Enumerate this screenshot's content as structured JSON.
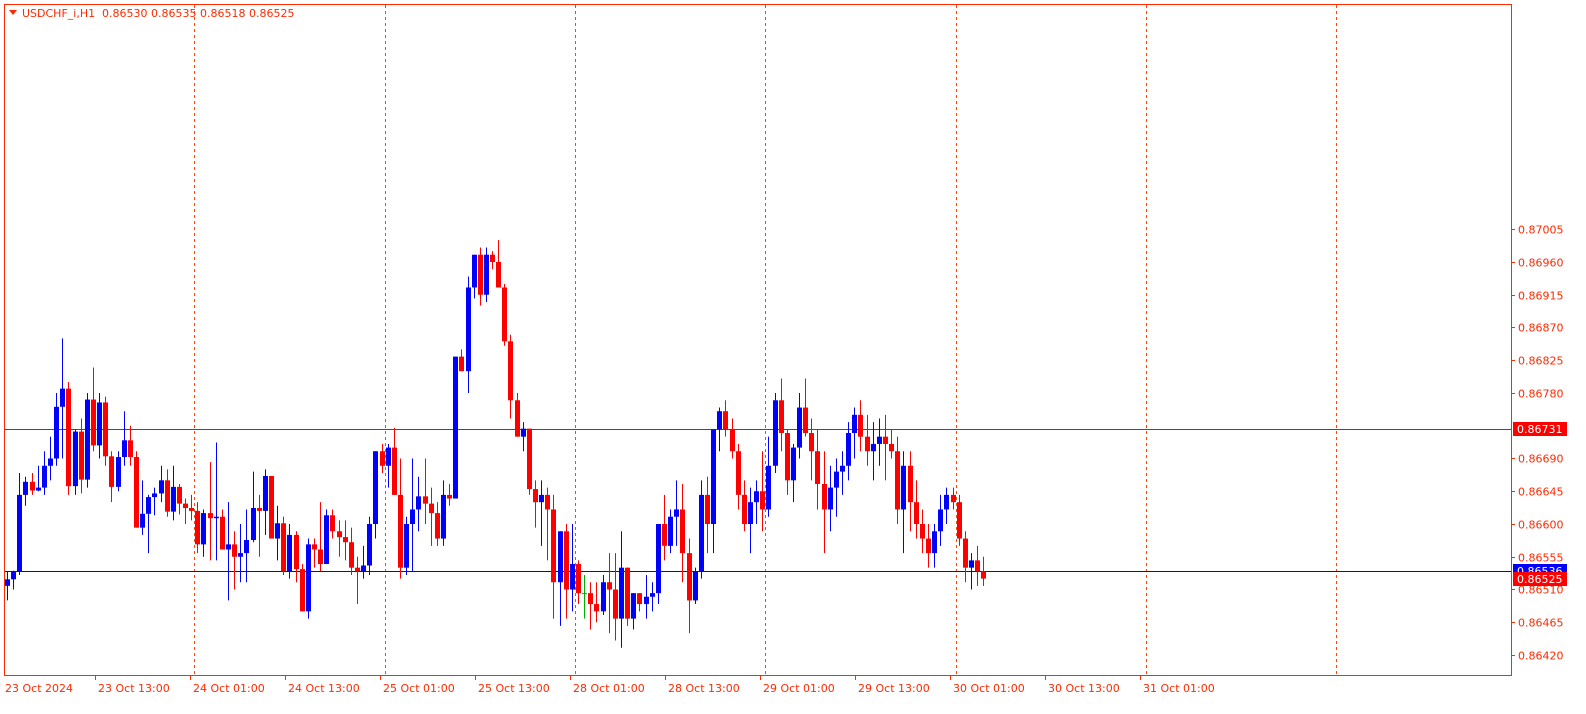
{
  "header": {
    "symbol_label": "USDCHF_i,H1",
    "ohlc_text": "0.86530 0.86535 0.86518 0.86525"
  },
  "colors": {
    "frame": "#ff2a00",
    "bull": "#0000ff",
    "bear": "#ff0000",
    "axis_text": "#ff2a00",
    "period_sep": "#ff4500",
    "hline_red": "#ff0000",
    "hline_blue": "#0000ff",
    "flat": "#00b000"
  },
  "chart_data": {
    "type": "candlestick",
    "symbol": "USDCHF_i",
    "timeframe": "H1",
    "ylim": [
      0.86405,
      0.8702
    ],
    "y_ticks": [
      "0.87005",
      "0.86960",
      "0.86915",
      "0.86870",
      "0.86825",
      "0.86780",
      "0.86690",
      "0.86645",
      "0.86600",
      "0.86555",
      "0.86510",
      "0.86465",
      "0.86420"
    ],
    "x_ticks": [
      "23 Oct 2024",
      "23 Oct 13:00",
      "24 Oct 01:00",
      "24 Oct 13:00",
      "25 Oct 01:00",
      "25 Oct 13:00",
      "28 Oct 01:00",
      "28 Oct 13:00",
      "29 Oct 01:00",
      "29 Oct 13:00",
      "30 Oct 01:00",
      "30 Oct 13:00",
      "31 Oct 01:00"
    ],
    "period_separators_after_candle": [
      30,
      61,
      92,
      123,
      154,
      185,
      216
    ],
    "horizontal_lines": [
      {
        "price": 0.86731,
        "label": "0.86731",
        "color": "#ff0000"
      },
      {
        "price": 0.86536,
        "label": "0.86536",
        "color": "#0000ff"
      }
    ],
    "bid_label": "0.86525",
    "grid": false,
    "candles": [
      [
        0.86515,
        0.86534,
        0.86495,
        0.86524
      ],
      [
        0.86524,
        0.86536,
        0.8651,
        0.86534
      ],
      [
        0.86534,
        0.8667,
        0.8653,
        0.8664
      ],
      [
        0.8664,
        0.86665,
        0.86625,
        0.86658
      ],
      [
        0.86658,
        0.8667,
        0.8664,
        0.86646
      ],
      [
        0.86646,
        0.8668,
        0.86645,
        0.8665
      ],
      [
        0.8665,
        0.867,
        0.8664,
        0.8668
      ],
      [
        0.8668,
        0.8672,
        0.8666,
        0.8669
      ],
      [
        0.8669,
        0.8678,
        0.8668,
        0.86761
      ],
      [
        0.86761,
        0.86855,
        0.8669,
        0.86786
      ],
      [
        0.86786,
        0.86795,
        0.8664,
        0.86652
      ],
      [
        0.86652,
        0.8673,
        0.8664,
        0.86727
      ],
      [
        0.86727,
        0.86745,
        0.86642,
        0.86661
      ],
      [
        0.86661,
        0.8678,
        0.8665,
        0.86771
      ],
      [
        0.86771,
        0.86815,
        0.867,
        0.86708
      ],
      [
        0.86708,
        0.8678,
        0.8669,
        0.86767
      ],
      [
        0.86767,
        0.86775,
        0.8668,
        0.86693
      ],
      [
        0.86693,
        0.867,
        0.8663,
        0.86651
      ],
      [
        0.86651,
        0.867,
        0.86645,
        0.86692
      ],
      [
        0.86692,
        0.86755,
        0.8668,
        0.86715
      ],
      [
        0.86715,
        0.86735,
        0.8668,
        0.86692
      ],
      [
        0.86692,
        0.867,
        0.866,
        0.86595
      ],
      [
        0.86595,
        0.8666,
        0.86585,
        0.86614
      ],
      [
        0.86614,
        0.8664,
        0.8656,
        0.86637
      ],
      [
        0.86637,
        0.8665,
        0.86612,
        0.86642
      ],
      [
        0.86642,
        0.8668,
        0.8663,
        0.8666
      ],
      [
        0.8666,
        0.86675,
        0.8661,
        0.86617
      ],
      [
        0.86617,
        0.8668,
        0.86605,
        0.86651
      ],
      [
        0.86651,
        0.86655,
        0.86613,
        0.86628
      ],
      [
        0.86628,
        0.86635,
        0.866,
        0.86622
      ],
      [
        0.86622,
        0.8664,
        0.86605,
        0.86618
      ],
      [
        0.86618,
        0.8663,
        0.8656,
        0.86572
      ],
      [
        0.86572,
        0.8662,
        0.86555,
        0.86615
      ],
      [
        0.86615,
        0.86685,
        0.8655,
        0.86608
      ],
      [
        0.86608,
        0.86712,
        0.8655,
        0.8661
      ],
      [
        0.8661,
        0.8662,
        0.8657,
        0.86565
      ],
      [
        0.86565,
        0.8663,
        0.86495,
        0.86572
      ],
      [
        0.86572,
        0.8659,
        0.8651,
        0.86555
      ],
      [
        0.86555,
        0.866,
        0.8652,
        0.8656
      ],
      [
        0.8656,
        0.8662,
        0.8652,
        0.86578
      ],
      [
        0.86578,
        0.86672,
        0.86575,
        0.86622
      ],
      [
        0.86622,
        0.8664,
        0.86555,
        0.86618
      ],
      [
        0.86618,
        0.86675,
        0.86585,
        0.86666
      ],
      [
        0.86666,
        0.8666,
        0.86585,
        0.8658
      ],
      [
        0.8658,
        0.86625,
        0.8655,
        0.86601
      ],
      [
        0.86601,
        0.8661,
        0.8653,
        0.86535
      ],
      [
        0.86535,
        0.866,
        0.86525,
        0.86585
      ],
      [
        0.86585,
        0.8659,
        0.8652,
        0.86538
      ],
      [
        0.86538,
        0.86545,
        0.86485,
        0.8648
      ],
      [
        0.8648,
        0.8658,
        0.8647,
        0.86572
      ],
      [
        0.86572,
        0.8658,
        0.8654,
        0.86565
      ],
      [
        0.86565,
        0.8663,
        0.86535,
        0.86545
      ],
      [
        0.86545,
        0.8662,
        0.86545,
        0.86612
      ],
      [
        0.86612,
        0.8662,
        0.8658,
        0.8659
      ],
      [
        0.8659,
        0.86605,
        0.86555,
        0.86582
      ],
      [
        0.86582,
        0.86605,
        0.8655,
        0.86575
      ],
      [
        0.86575,
        0.86595,
        0.8653,
        0.8654
      ],
      [
        0.8654,
        0.86555,
        0.8649,
        0.86535
      ],
      [
        0.86535,
        0.8657,
        0.86525,
        0.86543
      ],
      [
        0.86543,
        0.8661,
        0.8653,
        0.866
      ],
      [
        0.866,
        0.867,
        0.8658,
        0.867
      ],
      [
        0.867,
        0.8671,
        0.8667,
        0.8668
      ],
      [
        0.8668,
        0.8671,
        0.8665,
        0.86705
      ],
      [
        0.86705,
        0.86732,
        0.8664,
        0.8664
      ],
      [
        0.8664,
        0.8669,
        0.86525,
        0.8654
      ],
      [
        0.8654,
        0.8661,
        0.8653,
        0.866
      ],
      [
        0.866,
        0.8669,
        0.86535,
        0.8662
      ],
      [
        0.8662,
        0.86665,
        0.8659,
        0.86638
      ],
      [
        0.86638,
        0.8669,
        0.866,
        0.86628
      ],
      [
        0.86628,
        0.8665,
        0.8657,
        0.86615
      ],
      [
        0.86615,
        0.8663,
        0.8657,
        0.8658
      ],
      [
        0.8658,
        0.8666,
        0.8657,
        0.8664
      ],
      [
        0.8664,
        0.86655,
        0.86625,
        0.86635
      ],
      [
        0.86635,
        0.8683,
        0.8676,
        0.8683
      ],
      [
        0.8683,
        0.8684,
        0.8681,
        0.8681
      ],
      [
        0.8681,
        0.8694,
        0.8678,
        0.86925
      ],
      [
        0.86925,
        0.8697,
        0.8691,
        0.8697
      ],
      [
        0.8697,
        0.8698,
        0.869,
        0.86915
      ],
      [
        0.86915,
        0.8698,
        0.86905,
        0.8697
      ],
      [
        0.8697,
        0.86975,
        0.8695,
        0.8696
      ],
      [
        0.8696,
        0.8699,
        0.86925,
        0.86925
      ],
      [
        0.86925,
        0.8693,
        0.86845,
        0.86851
      ],
      [
        0.86851,
        0.8686,
        0.86745,
        0.8677
      ],
      [
        0.8677,
        0.8678,
        0.8672,
        0.8672
      ],
      [
        0.8672,
        0.8674,
        0.867,
        0.86731
      ],
      [
        0.86731,
        0.86731,
        0.8664,
        0.86648
      ],
      [
        0.86648,
        0.8666,
        0.86595,
        0.8663
      ],
      [
        0.8663,
        0.8666,
        0.8657,
        0.8664
      ],
      [
        0.8664,
        0.8665,
        0.8655,
        0.8662
      ],
      [
        0.8662,
        0.8664,
        0.8647,
        0.8652
      ],
      [
        0.8652,
        0.8658,
        0.8646,
        0.8659
      ],
      [
        0.8659,
        0.866,
        0.8647,
        0.8651
      ],
      [
        0.8651,
        0.866,
        0.8648,
        0.86545
      ],
      [
        0.86545,
        0.8655,
        0.8649,
        0.86505
      ],
      [
        0.86505,
        0.8653,
        0.8647,
        0.86505
      ],
      [
        0.86505,
        0.8652,
        0.86455,
        0.8649
      ],
      [
        0.8649,
        0.8652,
        0.86465,
        0.8648
      ],
      [
        0.8648,
        0.8653,
        0.86475,
        0.8652
      ],
      [
        0.8652,
        0.8656,
        0.8645,
        0.8651
      ],
      [
        0.8651,
        0.8656,
        0.8644,
        0.8647
      ],
      [
        0.8647,
        0.8659,
        0.8643,
        0.8654
      ],
      [
        0.8654,
        0.8652,
        0.8646,
        0.8647
      ],
      [
        0.8647,
        0.865,
        0.86455,
        0.86505
      ],
      [
        0.86505,
        0.865,
        0.8648,
        0.8649
      ],
      [
        0.8649,
        0.8653,
        0.8647,
        0.865
      ],
      [
        0.865,
        0.8652,
        0.8648,
        0.86505
      ],
      [
        0.86505,
        0.866,
        0.8649,
        0.866
      ],
      [
        0.866,
        0.8664,
        0.8655,
        0.8657
      ],
      [
        0.8657,
        0.8662,
        0.8656,
        0.8661
      ],
      [
        0.8661,
        0.8666,
        0.8657,
        0.8662
      ],
      [
        0.8662,
        0.86655,
        0.8652,
        0.8656
      ],
      [
        0.8656,
        0.8658,
        0.8645,
        0.86495
      ],
      [
        0.86495,
        0.8654,
        0.8649,
        0.86535
      ],
      [
        0.86535,
        0.8666,
        0.86525,
        0.8664
      ],
      [
        0.8664,
        0.86665,
        0.8656,
        0.866
      ],
      [
        0.866,
        0.8671,
        0.8656,
        0.8673
      ],
      [
        0.8673,
        0.8676,
        0.867,
        0.86755
      ],
      [
        0.86755,
        0.8677,
        0.8672,
        0.8673
      ],
      [
        0.8673,
        0.86745,
        0.8669,
        0.867
      ],
      [
        0.867,
        0.8671,
        0.8662,
        0.8664
      ],
      [
        0.8664,
        0.8666,
        0.8659,
        0.866
      ],
      [
        0.866,
        0.8665,
        0.8656,
        0.8663
      ],
      [
        0.8663,
        0.8666,
        0.866,
        0.86645
      ],
      [
        0.86645,
        0.867,
        0.8659,
        0.8662
      ],
      [
        0.8662,
        0.8672,
        0.8661,
        0.8668
      ],
      [
        0.8668,
        0.8678,
        0.8667,
        0.8677
      ],
      [
        0.8677,
        0.868,
        0.867,
        0.86725
      ],
      [
        0.86725,
        0.8673,
        0.8664,
        0.8666
      ],
      [
        0.8666,
        0.8671,
        0.8663,
        0.86705
      ],
      [
        0.86705,
        0.8678,
        0.8669,
        0.8676
      ],
      [
        0.8676,
        0.868,
        0.8672,
        0.86725
      ],
      [
        0.86725,
        0.86745,
        0.8666,
        0.867
      ],
      [
        0.867,
        0.8673,
        0.8662,
        0.86655
      ],
      [
        0.86655,
        0.867,
        0.8656,
        0.8662
      ],
      [
        0.8662,
        0.8668,
        0.8659,
        0.8665
      ],
      [
        0.8665,
        0.8669,
        0.8661,
        0.86672
      ],
      [
        0.86672,
        0.867,
        0.8664,
        0.8668
      ],
      [
        0.8668,
        0.8674,
        0.8666,
        0.86725
      ],
      [
        0.86725,
        0.8676,
        0.8669,
        0.8675
      ],
      [
        0.8675,
        0.8677,
        0.867,
        0.8672
      ],
      [
        0.8672,
        0.8675,
        0.8668,
        0.867
      ],
      [
        0.867,
        0.8674,
        0.8666,
        0.8671
      ],
      [
        0.8671,
        0.86745,
        0.8668,
        0.8672
      ],
      [
        0.8672,
        0.8675,
        0.8666,
        0.8671
      ],
      [
        0.8671,
        0.8673,
        0.8669,
        0.867
      ],
      [
        0.867,
        0.8672,
        0.866,
        0.8662
      ],
      [
        0.8662,
        0.867,
        0.8656,
        0.8668
      ],
      [
        0.8668,
        0.867,
        0.8659,
        0.8663
      ],
      [
        0.8663,
        0.8666,
        0.8658,
        0.866
      ],
      [
        0.866,
        0.8662,
        0.8656,
        0.8658
      ],
      [
        0.8658,
        0.866,
        0.8654,
        0.8656
      ],
      [
        0.8656,
        0.866,
        0.8654,
        0.8659
      ],
      [
        0.8659,
        0.8664,
        0.8657,
        0.8662
      ],
      [
        0.8662,
        0.8665,
        0.866,
        0.8664
      ],
      [
        0.8664,
        0.8665,
        0.8662,
        0.8663
      ],
      [
        0.8663,
        0.8664,
        0.8657,
        0.8658
      ],
      [
        0.8658,
        0.8659,
        0.8652,
        0.8654
      ],
      [
        0.8654,
        0.8656,
        0.8651,
        0.8655
      ],
      [
        0.8655,
        0.8657,
        0.86515,
        0.86535
      ],
      [
        0.86535,
        0.86555,
        0.86515,
        0.86525
      ]
    ]
  }
}
